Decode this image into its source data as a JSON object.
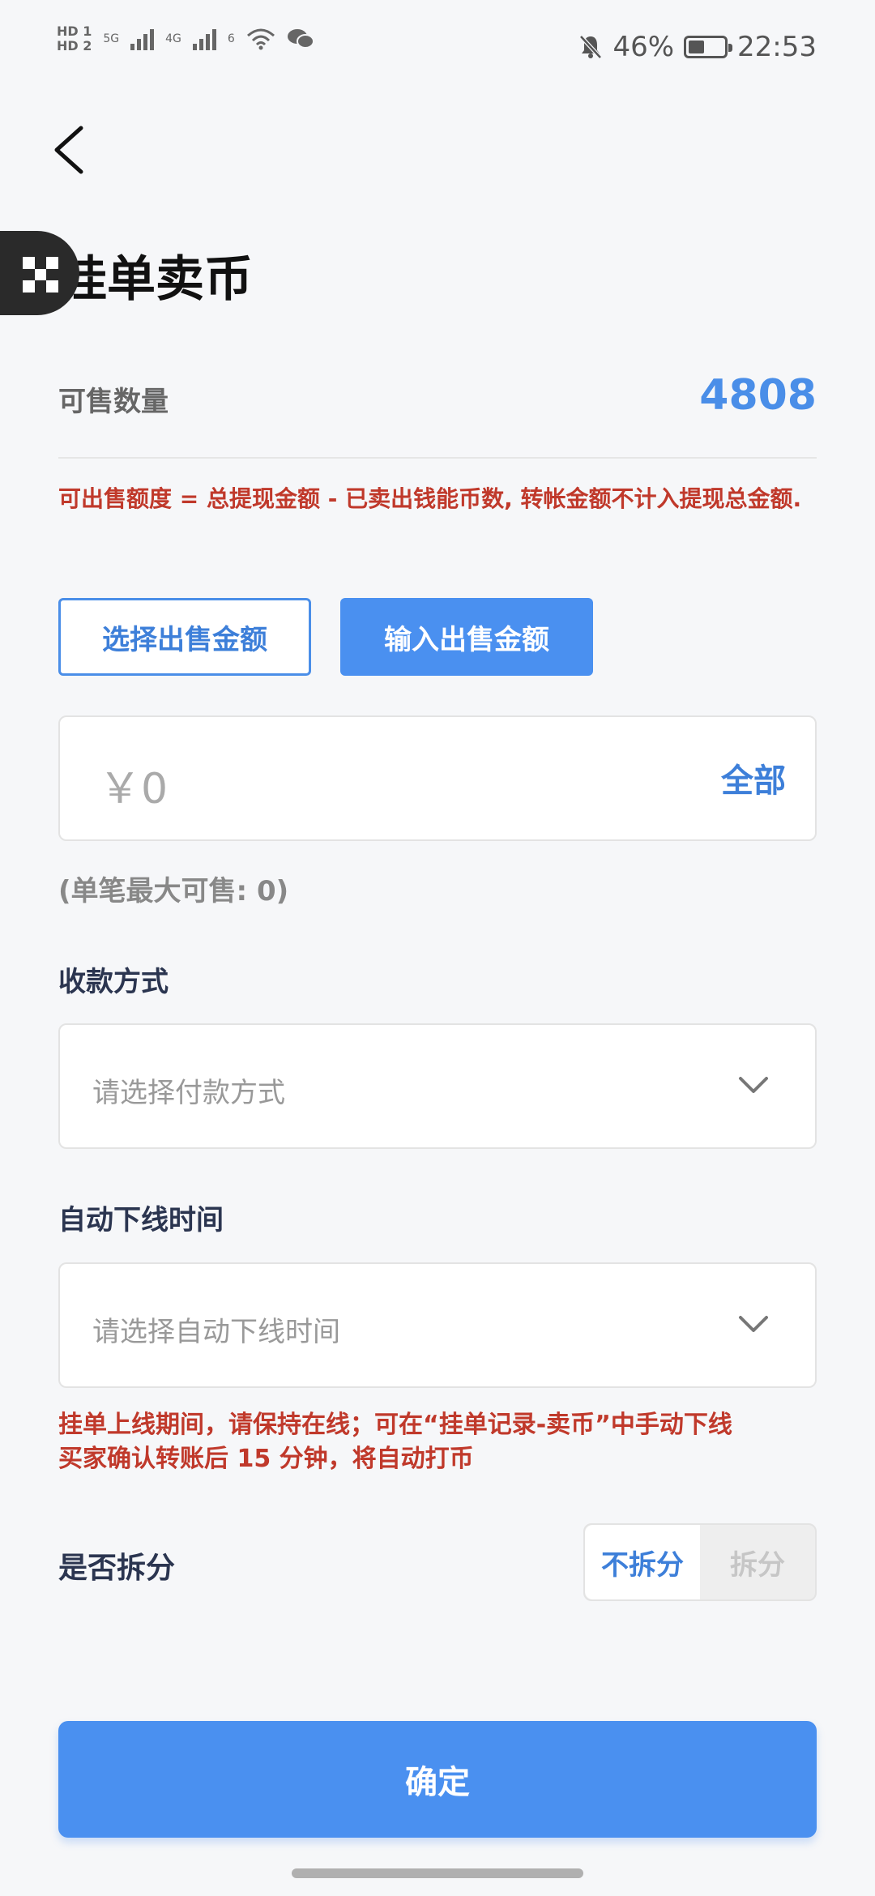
{
  "status_bar": {
    "hd1": "HD 1",
    "hd2": "HD 2",
    "net1": "5G",
    "net2": "4G",
    "wifi_badge": "6",
    "battery_text": "46%",
    "battery_level": 0.46,
    "time": "22:53",
    "icons": [
      "signal-icon",
      "wifi-icon",
      "wechat-icon",
      "bell-off-icon",
      "battery-icon"
    ]
  },
  "header": {
    "title": "挂单卖币",
    "back_icon": "chevron-left-icon"
  },
  "available": {
    "label": "可售数量",
    "value": "4808"
  },
  "quota_note": "可出售额度 = 总提现金额 - 已卖出钱能币数, 转帐金额不计入提现总金额.",
  "mode_buttons": {
    "select_label": "选择出售金额",
    "input_label": "输入出售金额"
  },
  "amount": {
    "value": "￥0",
    "all_label": "全部"
  },
  "max_note": "(单笔最大可售: 0)",
  "payment": {
    "label": "收款方式",
    "placeholder": "请选择付款方式"
  },
  "offline": {
    "label": "自动下线时间",
    "placeholder": "请选择自动下线时间"
  },
  "online_note": {
    "line1": "挂单上线期间，请保持在线；可在“挂单记录-卖币”中手动下线",
    "line2": "买家确认转账后 15 分钟，将自动打币"
  },
  "split": {
    "label": "是否拆分",
    "no_split": "不拆分",
    "split": "拆分"
  },
  "confirm_label": "确定",
  "colors": {
    "accent": "#4a90f0",
    "accent_text": "#3d7fd9",
    "warning": "#c0392b",
    "background": "#f6f7f9"
  }
}
